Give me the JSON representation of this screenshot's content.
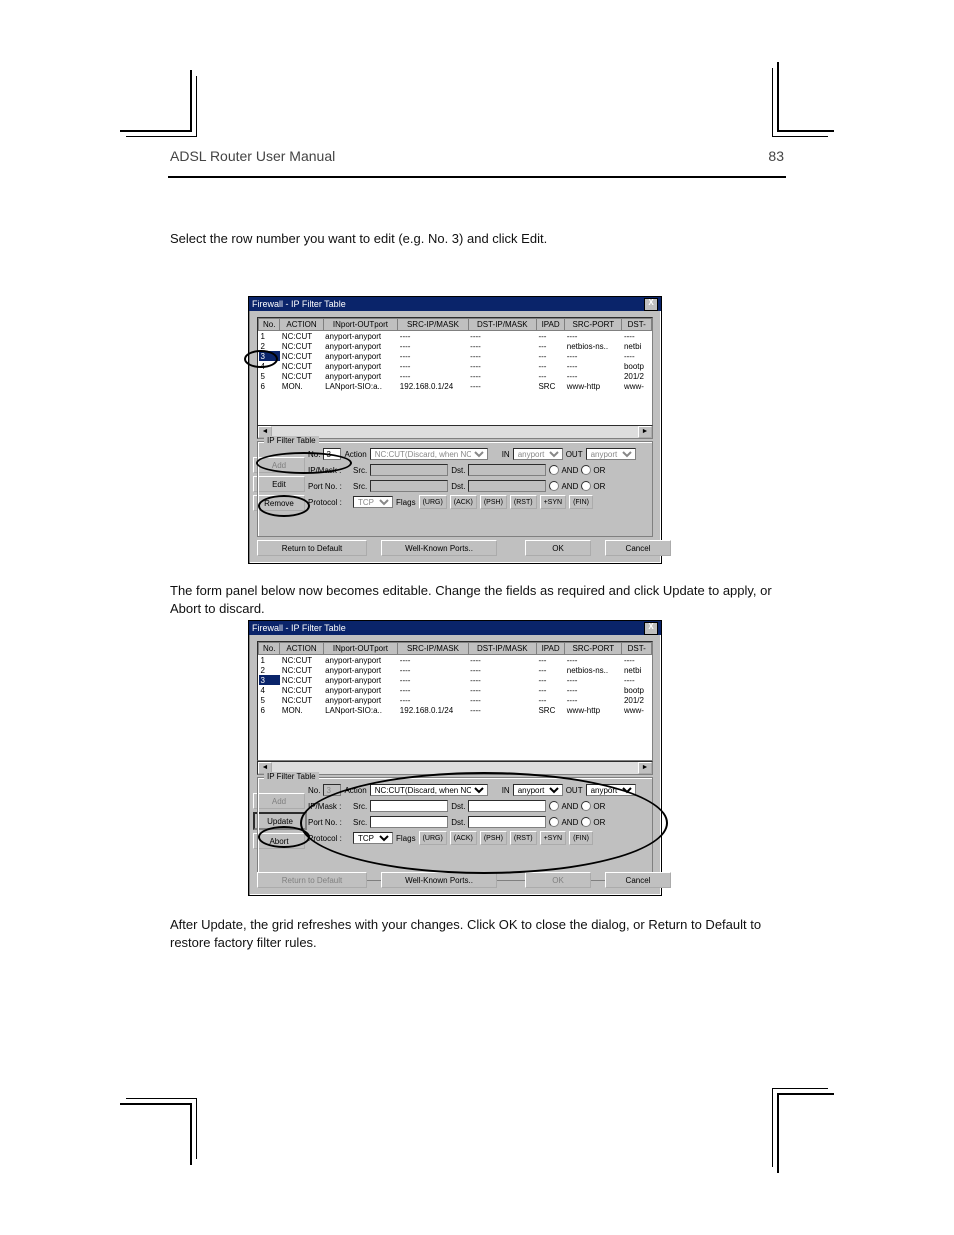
{
  "page": {
    "heading_left": "ADSL Router User Manual",
    "number": "83",
    "para1": "Select the row number you want to edit (e.g. No. 3) and click Edit.",
    "para2": "The form panel below now becomes editable. Change the fields as required and click Update to apply, or Abort to discard.",
    "para3": "After Update, the grid refreshes with your changes. Click OK to close the dialog, or Return to Default to restore factory filter rules."
  },
  "dialog": {
    "title": "Firewall - IP Filter Table",
    "close": "X",
    "columns": [
      "No.",
      "ACTION",
      "INport-OUTport",
      "SRC-IP/MASK",
      "DST-IP/MASK",
      "IPAD",
      "SRC-PORT",
      "DST-"
    ],
    "rows": [
      {
        "no": "1",
        "action": "NC:CUT",
        "io": "anyport-anyport",
        "src": "----",
        "dst": "----",
        "ipad": "---",
        "sport": "----",
        "dport": "----"
      },
      {
        "no": "2",
        "action": "NC:CUT",
        "io": "anyport-anyport",
        "src": "----",
        "dst": "----",
        "ipad": "---",
        "sport": "netbios-ns..",
        "dport": "netbi"
      },
      {
        "no": "3",
        "action": "NC:CUT",
        "io": "anyport-anyport",
        "src": "----",
        "dst": "----",
        "ipad": "---",
        "sport": "----",
        "dport": "----"
      },
      {
        "no": "4",
        "action": "NC:CUT",
        "io": "anyport-anyport",
        "src": "----",
        "dst": "----",
        "ipad": "---",
        "sport": "----",
        "dport": "bootp"
      },
      {
        "no": "5",
        "action": "NC:CUT",
        "io": "anyport-anyport",
        "src": "----",
        "dst": "----",
        "ipad": "---",
        "sport": "----",
        "dport": "201/2"
      },
      {
        "no": "6",
        "action": "MON.",
        "io": "LANport-SIO:a..",
        "src": "192.168.0.1/24",
        "dst": "----",
        "ipad": "SRC",
        "sport": "www-http",
        "dport": "www-"
      }
    ],
    "group_title": "IP Filter Table",
    "form": {
      "no_label": "No.",
      "no_value": "3",
      "action_label": "Action",
      "action_value": "NC:CUT(Discard, when NC)",
      "in_label": "IN",
      "in_value": "anyport",
      "out_label": "OUT",
      "out_value": "anyport",
      "ipmask_label": "IP/Mask :",
      "src_label": "Src.",
      "dst_label": "Dst.",
      "portno_label": "Port No. :",
      "protocol_label": "Protocol :",
      "protocol_value": "TCP",
      "flags_label": "Flags",
      "flags": [
        "(URG)",
        "(ACK)",
        "(PSH)",
        "(RST)",
        "+SYN",
        "(FIN)"
      ],
      "and_label": "AND",
      "or_label": "OR"
    },
    "buttons1": {
      "add": "Add",
      "edit": "Edit",
      "remove": "Remove"
    },
    "buttons2": {
      "add": "Add",
      "update": "Update",
      "abort": "Abort"
    },
    "bottom": {
      "rtd": "Return to Default",
      "wkp": "Well-Known Ports..",
      "ok": "OK",
      "cancel": "Cancel"
    }
  }
}
